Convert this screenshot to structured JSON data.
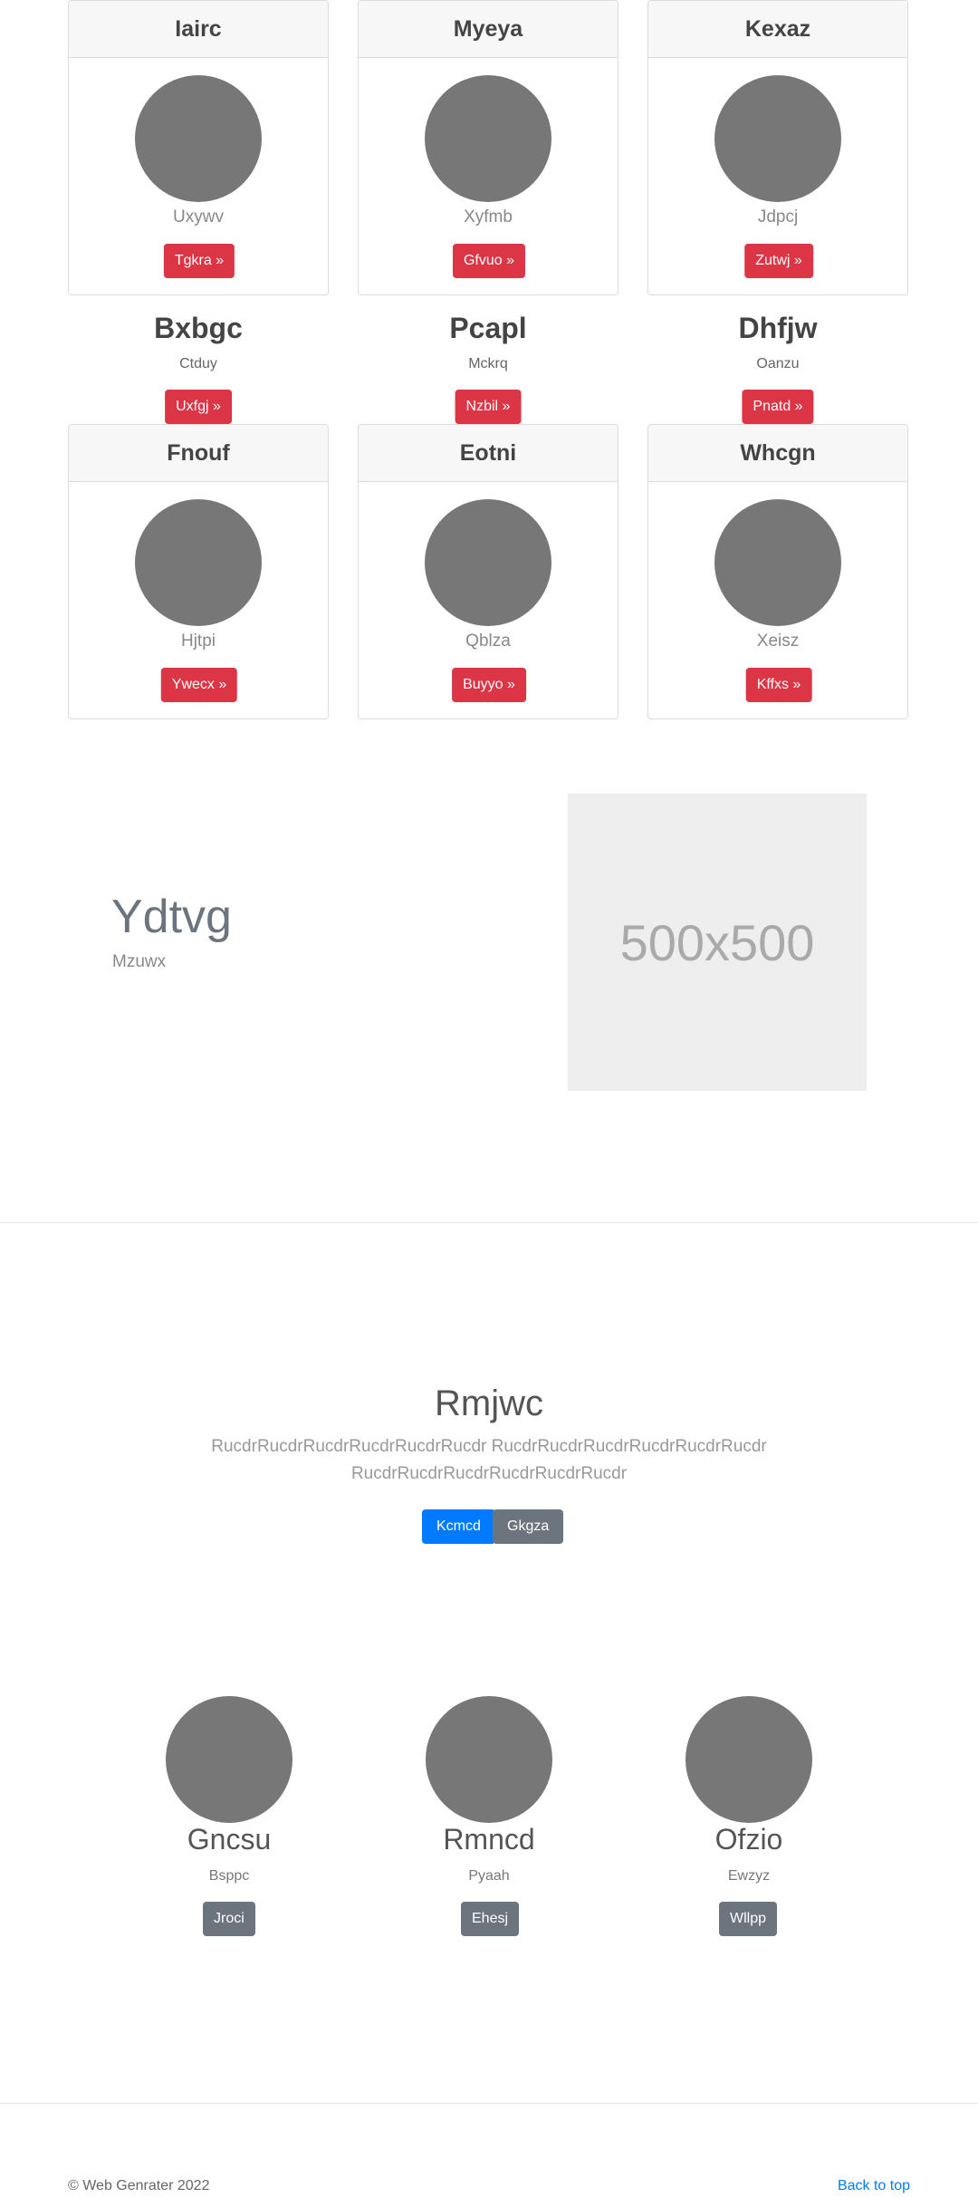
{
  "cards_top": [
    {
      "title": "Iairc",
      "sub": "Uxywv",
      "button": "Tgkra »"
    },
    {
      "title": "Myeya",
      "sub": "Xyfmb",
      "button": "Gfvuo »"
    },
    {
      "title": "Kexaz",
      "sub": "Jdpcj",
      "button": "Zutwj »"
    }
  ],
  "mid_items": [
    {
      "title": "Bxbgc",
      "sub": "Ctduy",
      "button": "Uxfgj »"
    },
    {
      "title": "Pcapl",
      "sub": "Mckrq",
      "button": "Nzbil »"
    },
    {
      "title": "Dhfjw",
      "sub": "Oanzu",
      "button": "Pnatd »"
    }
  ],
  "cards_bottom": [
    {
      "title": "Fnouf",
      "sub": "Hjtpi",
      "button": "Ywecx »"
    },
    {
      "title": "Eotni",
      "sub": "Qblza",
      "button": "Buyyo »"
    },
    {
      "title": "Whcgn",
      "sub": "Xeisz",
      "button": "Kffxs »"
    }
  ],
  "feature": {
    "title": "Ydtvg",
    "sub": "Mzuwx",
    "placeholder": "500x500"
  },
  "jumbotron": {
    "title": "Rmjwc",
    "lead": "RucdrRucdrRucdrRucdrRucdrRucdr RucdrRucdrRucdrRucdrRucdrRucdr RucdrRucdrRucdrRucdrRucdrRucdr",
    "primary_button": "Kcmcd",
    "secondary_button": "Gkgza"
  },
  "people": [
    {
      "name": "Gncsu",
      "sub": "Bsppc",
      "button": "Jroci"
    },
    {
      "name": "Rmncd",
      "sub": "Pyaah",
      "button": "Ehesj"
    },
    {
      "name": "Ofzio",
      "sub": "Ewzyz",
      "button": "Wllpp"
    }
  ],
  "footer": {
    "copyright": "© Web Genrater 2022",
    "back_to_top": "Back to top"
  }
}
